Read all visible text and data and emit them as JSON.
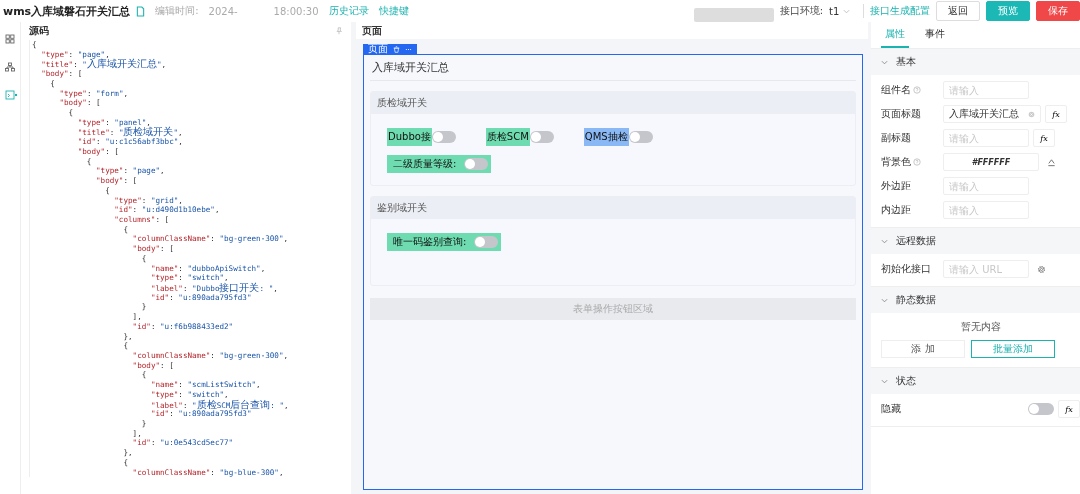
{
  "header": {
    "title": "wms入库域磐石开关汇总",
    "edit_label": "编辑时间:",
    "edit_date": "2024-",
    "edit_time": "18:00:30",
    "links": [
      "历史记录",
      "快捷键"
    ],
    "env_label": "接口环境:",
    "env_value": "t1",
    "config_link": "接口生成配置",
    "buttons": [
      {
        "label": "返回",
        "kind": "plain"
      },
      {
        "label": "预览",
        "kind": "primary"
      },
      {
        "label": "保存",
        "kind": "danger"
      }
    ]
  },
  "rail": [
    {
      "kind": "grid",
      "selected": false
    },
    {
      "kind": "tree",
      "selected": false
    },
    {
      "kind": "code",
      "selected": true
    }
  ],
  "source": {
    "title": "源码",
    "lines": [
      "{",
      "  \"type\": \"page\",",
      "  \"title\": \"入库域开关汇总\",",
      "  \"body\": [",
      "    {",
      "      \"type\": \"form\",",
      "      \"body\": [",
      "        {",
      "          \"type\": \"panel\",",
      "          \"title\": \"质检域开关\",",
      "          \"id\": \"u:c1c56abf3bbc\",",
      "          \"body\": [",
      "            {",
      "              \"type\": \"page\",",
      "              \"body\": [",
      "                {",
      "                  \"type\": \"grid\",",
      "                  \"id\": \"u:d490d1b10ebe\",",
      "                  \"columns\": [",
      "                    {",
      "                      \"columnClassName\": \"bg-green-300\",",
      "                      \"body\": [",
      "                        {",
      "                          \"name\": \"dubboApiSwitch\",",
      "                          \"type\": \"switch\",",
      "                          \"label\": \"Dubbo接口开关: \",",
      "                          \"id\": \"u:890ada795fd3\"",
      "                        }",
      "                      ],",
      "                      \"id\": \"u:f6b988433ed2\"",
      "                    },",
      "                    {",
      "                      \"columnClassName\": \"bg-green-300\",",
      "                      \"body\": [",
      "                        {",
      "                          \"name\": \"scmListSwitch\",",
      "                          \"type\": \"switch\",",
      "                          \"label\": \"质检SCM后台查询: \",",
      "                          \"id\": \"u:890ada795fd3\"",
      "                        }",
      "                      ],",
      "                      \"id\": \"u:0e543cd5ec77\"",
      "                    },",
      "                    {",
      "                      \"columnClassName\": \"bg-blue-300\","
    ]
  },
  "canvas": {
    "title": "页面",
    "tag": "页面",
    "page_title": "入库域开关汇总",
    "panels": [
      {
        "title": "质检域开关",
        "rows": [
          [
            {
              "label": "Dubbo接",
              "color": "#6edcb0",
              "kind": "column",
              "on": false
            },
            {
              "label": "质检SCM",
              "color": "#6edcb0",
              "kind": "column",
              "on": false
            },
            {
              "label": "QMS抽检",
              "color": "#8ab8f5",
              "kind": "column",
              "on": false
            }
          ],
          [
            {
              "label": "二级质量等级:",
              "color": "#6edcb0",
              "kind": "block",
              "on": false
            }
          ]
        ]
      },
      {
        "title": "鉴别域开关",
        "rows": [
          [
            {
              "label": "唯一码鉴别查询:",
              "color": "#6edcb0",
              "kind": "block",
              "on": false
            }
          ]
        ]
      }
    ],
    "action_area": "表单操作按钮区域"
  },
  "inspector": {
    "tabs": [
      {
        "label": "属性",
        "selected": true
      },
      {
        "label": "事件",
        "selected": false
      }
    ],
    "sections": [
      {
        "title": "基本",
        "expanded": true,
        "items": [
          {
            "kind": "field",
            "label": "组件名",
            "help": true,
            "placeholder": "请输入"
          },
          {
            "kind": "field",
            "label": "页面标题",
            "help": false,
            "value": "入库域开关汇总",
            "clearable": true,
            "action": "fx"
          },
          {
            "kind": "field",
            "label": "副标题",
            "help": false,
            "placeholder": "请输入",
            "action": "fx"
          },
          {
            "kind": "color",
            "label": "背景色",
            "help": true,
            "value": "#FFFFFF"
          },
          {
            "kind": "field",
            "label": "外边距",
            "help": false,
            "placeholder": "请输入"
          },
          {
            "kind": "field",
            "label": "内边距",
            "help": false,
            "placeholder": "请输入"
          }
        ]
      },
      {
        "title": "远程数据",
        "expanded": true,
        "items": [
          {
            "kind": "url",
            "label": "初始化接口",
            "help": false,
            "placeholder": "请输入 URL"
          }
        ]
      },
      {
        "title": "静态数据",
        "expanded": true,
        "items": [
          {
            "kind": "empty",
            "text": "暂无内容"
          },
          {
            "kind": "buttons",
            "buttons": [
              {
                "label": "添 加",
                "primary": false
              },
              {
                "label": "批量添加",
                "primary": true
              }
            ]
          }
        ]
      },
      {
        "title": "状态",
        "expanded": true,
        "items": [
          {
            "kind": "switch",
            "label": "隐藏",
            "on": false,
            "action": "fx"
          }
        ]
      }
    ]
  }
}
